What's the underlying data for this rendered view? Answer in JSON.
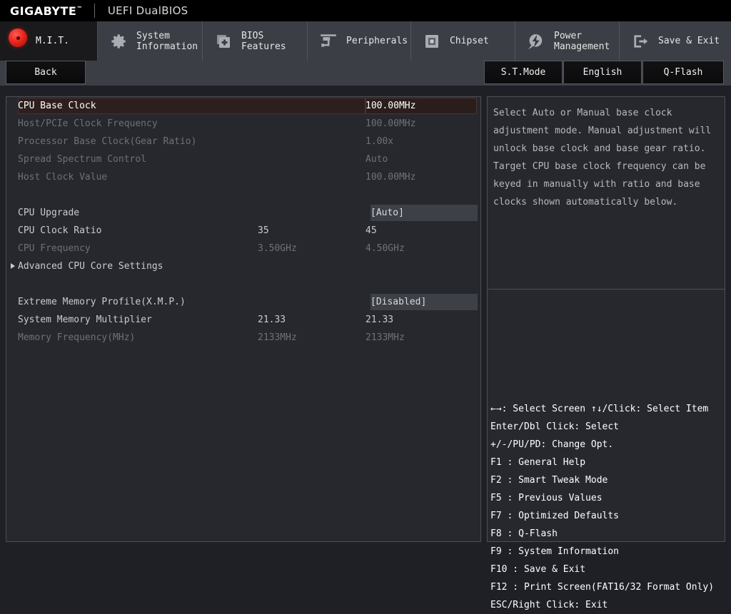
{
  "logobar": {
    "brand": "GIGABYTE",
    "trademark": "™",
    "subtitle": "UEFI DualBIOS"
  },
  "nav": {
    "tabs": [
      {
        "id": "mit",
        "label": "M.I.T.",
        "icon": "red-circle-icon",
        "active": true
      },
      {
        "id": "sysinfo",
        "label": "System\nInformation",
        "icon": "gear-icon",
        "active": false
      },
      {
        "id": "biosfeat",
        "label": "BIOS\nFeatures",
        "icon": "bios-chip-icon",
        "active": false
      },
      {
        "id": "periph",
        "label": "Peripherals",
        "icon": "peripherals-icon",
        "active": false
      },
      {
        "id": "chipset",
        "label": "Chipset",
        "icon": "chipset-icon",
        "active": false
      },
      {
        "id": "power",
        "label": "Power\nManagement",
        "icon": "power-bolt-icon",
        "active": false
      },
      {
        "id": "saveexit",
        "label": "Save & Exit",
        "icon": "exit-door-icon",
        "active": false
      }
    ]
  },
  "subbar": {
    "back_label": "Back",
    "stmode_label": "S.T.Mode",
    "english_label": "English",
    "qflash_label": "Q-Flash"
  },
  "settings": {
    "rows": [
      {
        "label": "CPU Base Clock",
        "mid": "",
        "value": "100.00MHz",
        "state": "selected"
      },
      {
        "label": "Host/PCIe Clock Frequency",
        "mid": "",
        "value": "100.00MHz",
        "state": "dim"
      },
      {
        "label": "Processor Base Clock(Gear Ratio)",
        "mid": "",
        "value": "1.00x",
        "state": "dim"
      },
      {
        "label": "Spread Spectrum Control",
        "mid": "",
        "value": "Auto",
        "state": "dim"
      },
      {
        "label": "Host Clock Value",
        "mid": "",
        "value": "100.00MHz",
        "state": "dim"
      },
      {
        "label": "",
        "mid": "",
        "value": "",
        "state": "spacer"
      },
      {
        "label": "CPU Upgrade",
        "mid": "",
        "value": "[Auto]",
        "state": "option"
      },
      {
        "label": "CPU Clock Ratio",
        "mid": "35",
        "value": "45",
        "state": "normal"
      },
      {
        "label": "CPU Frequency",
        "mid": "3.50GHz",
        "value": "4.50GHz",
        "state": "dim"
      },
      {
        "label": "Advanced CPU Core Settings",
        "mid": "",
        "value": "",
        "state": "submenu"
      },
      {
        "label": "",
        "mid": "",
        "value": "",
        "state": "spacer"
      },
      {
        "label": "Extreme Memory Profile(X.M.P.)",
        "mid": "",
        "value": "[Disabled]",
        "state": "option"
      },
      {
        "label": "System Memory Multiplier",
        "mid": "21.33",
        "value": "21.33",
        "state": "normal"
      },
      {
        "label": "Memory Frequency(MHz)",
        "mid": "2133MHz",
        "value": "2133MHz",
        "state": "dim"
      }
    ]
  },
  "help": {
    "lines": [
      "Select Auto or Manual base clock",
      "adjustment mode. Manual adjustment will",
      "unlock base clock and base gear ratio.",
      "Target CPU base clock frequency can be",
      "keyed in manually with ratio and base",
      "clocks shown automatically below."
    ]
  },
  "legend": {
    "header": "←→: Select Screen   ↑↓/Click: Select Item",
    "lines": [
      "Enter/Dbl Click: Select",
      "+/-/PU/PD: Change Opt.",
      "F1  : General Help",
      "F2  : Smart Tweak Mode",
      "F5  : Previous Values",
      "F7  : Optimized Defaults",
      "F8  : Q-Flash",
      "F9  : System Information",
      "F10 : Save & Exit",
      "F12 : Print Screen(FAT16/32 Format Only)",
      "ESC/Right Click: Exit"
    ]
  },
  "colors": {
    "background": "#1e2025",
    "panel": "#26282e",
    "navbar": "#3b3e45",
    "accent_red": "#e8241c",
    "selected_row": "#2d1f1e",
    "text": "#c9cbd0",
    "text_dim": "#6e7178"
  }
}
